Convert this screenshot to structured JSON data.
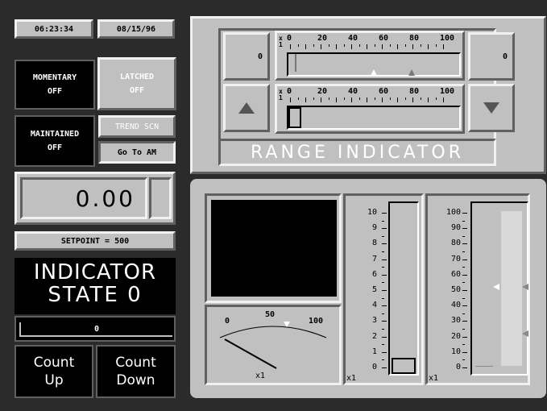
{
  "clock": {
    "time": "06:23:34",
    "date": "08/15/96"
  },
  "buttons": {
    "momentary": {
      "label": "MOMENTARY",
      "state": "OFF"
    },
    "latched": {
      "label": "LATCHED",
      "state": "OFF"
    },
    "maintained": {
      "label": "MAINTAINED",
      "state": "OFF"
    },
    "trend": "TREND SCN",
    "goto_am": "Go To AM"
  },
  "display": {
    "value": "0.00",
    "setpoint": "SETPOINT = 500"
  },
  "indicator": {
    "line1": "INDICATOR",
    "line2": "STATE 0",
    "count": "0"
  },
  "count_buttons": {
    "up": "Count\nUp",
    "down": "Count\nDown"
  },
  "range_indicator": {
    "title": "RANGE INDICATOR",
    "left_value": "0",
    "right_value": "0",
    "x_label": "x",
    "x_digit": "1",
    "scale_labels": [
      "0",
      "20",
      "40",
      "60",
      "80",
      "100"
    ],
    "up_icon": "up-arrow-icon",
    "down_icon": "down-arrow-icon"
  },
  "meter": {
    "labels": [
      "0",
      "50",
      "100"
    ],
    "multiplier": "x1"
  },
  "bar1": {
    "labels": [
      "10",
      "9",
      "8",
      "7",
      "6",
      "5",
      "4",
      "3",
      "2",
      "1",
      "0"
    ],
    "multiplier": "x1"
  },
  "bar2": {
    "labels": [
      "100",
      "90",
      "80",
      "70",
      "60",
      "50",
      "40",
      "30",
      "20",
      "10",
      "0"
    ],
    "multiplier": "x1"
  },
  "colors": {
    "background": "#2b2b2b",
    "panel": "#c0c0c0",
    "dark": "#000000"
  }
}
